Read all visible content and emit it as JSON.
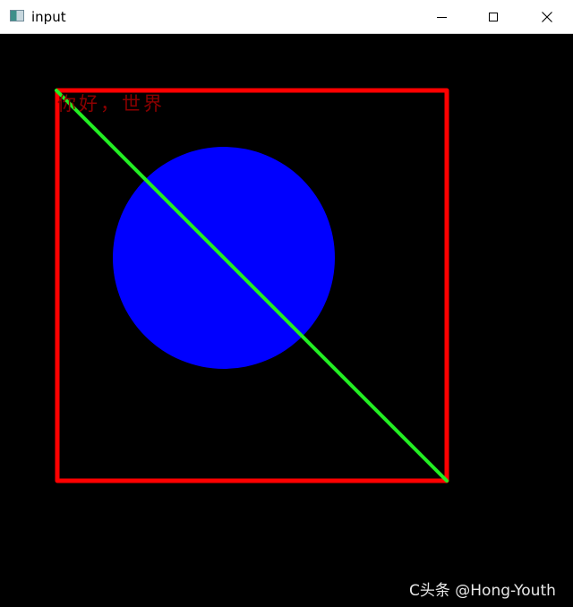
{
  "window": {
    "title": "input",
    "icon": "app-window-icon",
    "controls": {
      "minimize": "minimize-icon",
      "maximize": "maximize-icon",
      "close": "close-icon"
    }
  },
  "canvas": {
    "background": "#000000",
    "rectangle": {
      "color": "#ff0000"
    },
    "circle": {
      "color": "#0000ff"
    },
    "line": {
      "color": "#22ee22"
    },
    "text": {
      "value": "你好，世界",
      "color": "#8b0000"
    }
  },
  "watermark": {
    "text": "C头条 @Hong-Youth"
  }
}
